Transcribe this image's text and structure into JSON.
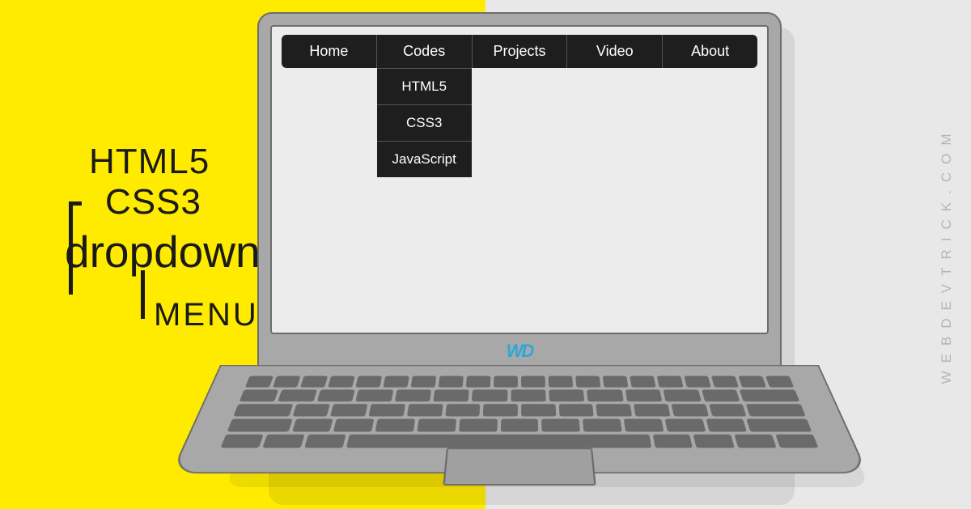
{
  "title": {
    "line1": "HTML5",
    "line2": "CSS3",
    "line3": "dropdown",
    "line4": "MENU"
  },
  "nav": {
    "items": [
      {
        "label": "Home"
      },
      {
        "label": "Codes",
        "submenu": [
          {
            "label": "HTML5"
          },
          {
            "label": "CSS3"
          },
          {
            "label": "JavaScript"
          }
        ]
      },
      {
        "label": "Projects"
      },
      {
        "label": "Video"
      },
      {
        "label": "About"
      }
    ]
  },
  "laptop_logo": "WD",
  "watermark": "WEBDEVTRICK.COM"
}
